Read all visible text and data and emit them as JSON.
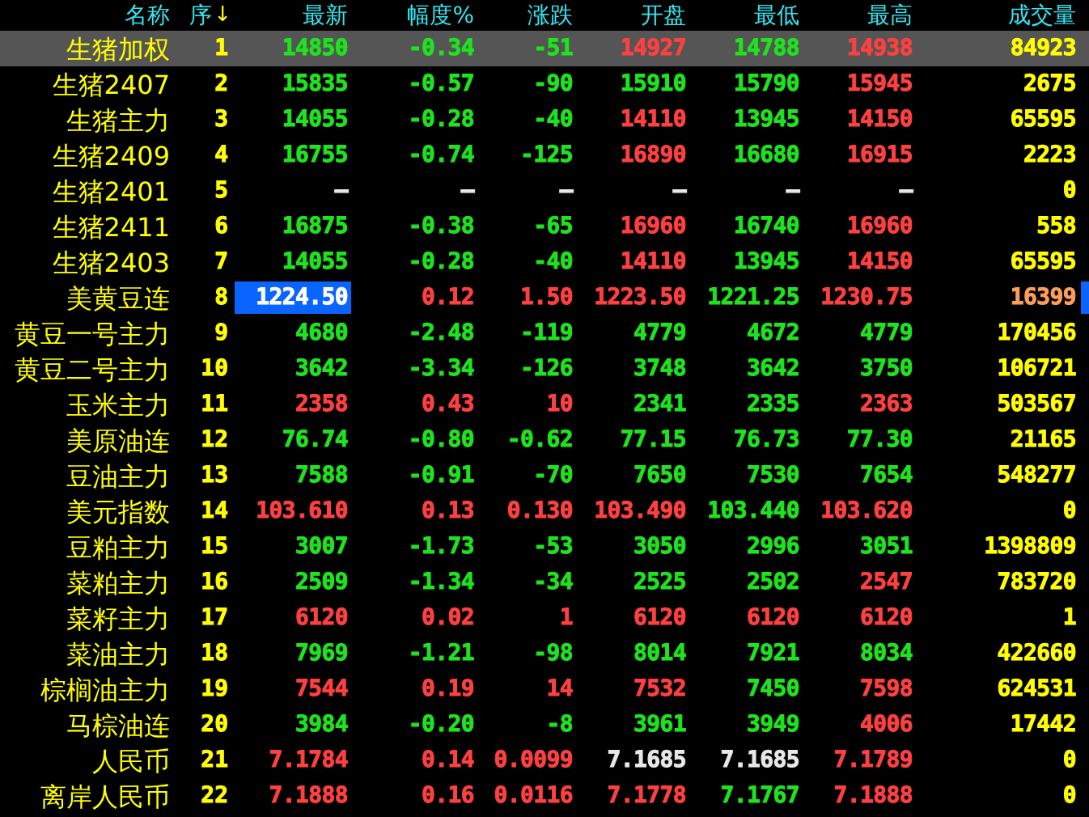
{
  "table": {
    "columns": [
      {
        "label": "名称"
      },
      {
        "label": "序",
        "sort_arrow": "↓"
      },
      {
        "label": "最新"
      },
      {
        "label": "幅度%"
      },
      {
        "label": "涨跌"
      },
      {
        "label": "开盘"
      },
      {
        "label": "最低"
      },
      {
        "label": "最高"
      },
      {
        "label": "成交量"
      }
    ],
    "rows": [
      {
        "selected": true,
        "latest_highlighted": false,
        "marked": false,
        "cells": [
          {
            "text": "生猪加权",
            "color": "#ffff00"
          },
          {
            "text": "1",
            "color": "#ffff00"
          },
          {
            "text": "14850",
            "color": "#1ee31e"
          },
          {
            "text": "-0.34",
            "color": "#1ee31e"
          },
          {
            "text": "-51",
            "color": "#1ee31e"
          },
          {
            "text": "14927",
            "color": "#ff4040"
          },
          {
            "text": "14788",
            "color": "#1ee31e"
          },
          {
            "text": "14938",
            "color": "#ff4040"
          },
          {
            "text": "84923",
            "color": "#ffff00"
          }
        ]
      },
      {
        "selected": false,
        "latest_highlighted": false,
        "marked": false,
        "cells": [
          {
            "text": "生猪2407",
            "color": "#ffff00"
          },
          {
            "text": "2",
            "color": "#ffff00"
          },
          {
            "text": "15835",
            "color": "#1ee31e"
          },
          {
            "text": "-0.57",
            "color": "#1ee31e"
          },
          {
            "text": "-90",
            "color": "#1ee31e"
          },
          {
            "text": "15910",
            "color": "#1ee31e"
          },
          {
            "text": "15790",
            "color": "#1ee31e"
          },
          {
            "text": "15945",
            "color": "#ff4040"
          },
          {
            "text": "2675",
            "color": "#ffff00"
          }
        ]
      },
      {
        "selected": false,
        "latest_highlighted": false,
        "marked": false,
        "cells": [
          {
            "text": "生猪主力",
            "color": "#ffff00"
          },
          {
            "text": "3",
            "color": "#ffff00"
          },
          {
            "text": "14055",
            "color": "#1ee31e"
          },
          {
            "text": "-0.28",
            "color": "#1ee31e"
          },
          {
            "text": "-40",
            "color": "#1ee31e"
          },
          {
            "text": "14110",
            "color": "#ff4040"
          },
          {
            "text": "13945",
            "color": "#1ee31e"
          },
          {
            "text": "14150",
            "color": "#ff4040"
          },
          {
            "text": "65595",
            "color": "#ffff00"
          }
        ]
      },
      {
        "selected": false,
        "latest_highlighted": false,
        "marked": false,
        "cells": [
          {
            "text": "生猪2409",
            "color": "#ffff00"
          },
          {
            "text": "4",
            "color": "#ffff00"
          },
          {
            "text": "16755",
            "color": "#1ee31e"
          },
          {
            "text": "-0.74",
            "color": "#1ee31e"
          },
          {
            "text": "-125",
            "color": "#1ee31e"
          },
          {
            "text": "16890",
            "color": "#ff4040"
          },
          {
            "text": "16680",
            "color": "#1ee31e"
          },
          {
            "text": "16915",
            "color": "#ff4040"
          },
          {
            "text": "2223",
            "color": "#ffff00"
          }
        ]
      },
      {
        "selected": false,
        "latest_highlighted": false,
        "marked": false,
        "cells": [
          {
            "text": "生猪2401",
            "color": "#ffff00"
          },
          {
            "text": "5",
            "color": "#ffff00"
          },
          {
            "text": "—",
            "color": "#e8e8e8"
          },
          {
            "text": "—",
            "color": "#e8e8e8"
          },
          {
            "text": "—",
            "color": "#e8e8e8"
          },
          {
            "text": "—",
            "color": "#e8e8e8"
          },
          {
            "text": "—",
            "color": "#e8e8e8"
          },
          {
            "text": "—",
            "color": "#e8e8e8"
          },
          {
            "text": "0",
            "color": "#ffff00"
          }
        ]
      },
      {
        "selected": false,
        "latest_highlighted": false,
        "marked": false,
        "cells": [
          {
            "text": "生猪2411",
            "color": "#ffff00"
          },
          {
            "text": "6",
            "color": "#ffff00"
          },
          {
            "text": "16875",
            "color": "#1ee31e"
          },
          {
            "text": "-0.38",
            "color": "#1ee31e"
          },
          {
            "text": "-65",
            "color": "#1ee31e"
          },
          {
            "text": "16960",
            "color": "#ff4040"
          },
          {
            "text": "16740",
            "color": "#1ee31e"
          },
          {
            "text": "16960",
            "color": "#ff4040"
          },
          {
            "text": "558",
            "color": "#ffff00"
          }
        ]
      },
      {
        "selected": false,
        "latest_highlighted": false,
        "marked": false,
        "cells": [
          {
            "text": "生猪2403",
            "color": "#ffff00"
          },
          {
            "text": "7",
            "color": "#ffff00"
          },
          {
            "text": "14055",
            "color": "#1ee31e"
          },
          {
            "text": "-0.28",
            "color": "#1ee31e"
          },
          {
            "text": "-40",
            "color": "#1ee31e"
          },
          {
            "text": "14110",
            "color": "#ff4040"
          },
          {
            "text": "13945",
            "color": "#1ee31e"
          },
          {
            "text": "14150",
            "color": "#ff4040"
          },
          {
            "text": "65595",
            "color": "#ffff00"
          }
        ]
      },
      {
        "selected": false,
        "latest_highlighted": true,
        "marked": true,
        "cells": [
          {
            "text": "美黄豆连",
            "color": "#ffff00"
          },
          {
            "text": "8",
            "color": "#ffff00"
          },
          {
            "text": "1224.50",
            "color": "#ffffff"
          },
          {
            "text": "0.12",
            "color": "#ff4040"
          },
          {
            "text": "1.50",
            "color": "#ff4040"
          },
          {
            "text": "1223.50",
            "color": "#ff4040"
          },
          {
            "text": "1221.25",
            "color": "#1ee31e"
          },
          {
            "text": "1230.75",
            "color": "#ff4040"
          },
          {
            "text": "16399",
            "color": "#ff9e5a"
          }
        ]
      },
      {
        "selected": false,
        "latest_highlighted": false,
        "marked": false,
        "cells": [
          {
            "text": "黄豆一号主力",
            "color": "#ffff00"
          },
          {
            "text": "9",
            "color": "#ffff00"
          },
          {
            "text": "4680",
            "color": "#1ee31e"
          },
          {
            "text": "-2.48",
            "color": "#1ee31e"
          },
          {
            "text": "-119",
            "color": "#1ee31e"
          },
          {
            "text": "4779",
            "color": "#1ee31e"
          },
          {
            "text": "4672",
            "color": "#1ee31e"
          },
          {
            "text": "4779",
            "color": "#1ee31e"
          },
          {
            "text": "170456",
            "color": "#ffff00"
          }
        ]
      },
      {
        "selected": false,
        "latest_highlighted": false,
        "marked": false,
        "cells": [
          {
            "text": "黄豆二号主力",
            "color": "#ffff00"
          },
          {
            "text": "10",
            "color": "#ffff00"
          },
          {
            "text": "3642",
            "color": "#1ee31e"
          },
          {
            "text": "-3.34",
            "color": "#1ee31e"
          },
          {
            "text": "-126",
            "color": "#1ee31e"
          },
          {
            "text": "3748",
            "color": "#1ee31e"
          },
          {
            "text": "3642",
            "color": "#1ee31e"
          },
          {
            "text": "3750",
            "color": "#1ee31e"
          },
          {
            "text": "106721",
            "color": "#ffff00"
          }
        ]
      },
      {
        "selected": false,
        "latest_highlighted": false,
        "marked": false,
        "cells": [
          {
            "text": "玉米主力",
            "color": "#ffff00"
          },
          {
            "text": "11",
            "color": "#ffff00"
          },
          {
            "text": "2358",
            "color": "#ff4040"
          },
          {
            "text": "0.43",
            "color": "#ff4040"
          },
          {
            "text": "10",
            "color": "#ff4040"
          },
          {
            "text": "2341",
            "color": "#1ee31e"
          },
          {
            "text": "2335",
            "color": "#1ee31e"
          },
          {
            "text": "2363",
            "color": "#ff4040"
          },
          {
            "text": "503567",
            "color": "#ffff00"
          }
        ]
      },
      {
        "selected": false,
        "latest_highlighted": false,
        "marked": false,
        "cells": [
          {
            "text": "美原油连",
            "color": "#ffff00"
          },
          {
            "text": "12",
            "color": "#ffff00"
          },
          {
            "text": "76.74",
            "color": "#1ee31e"
          },
          {
            "text": "-0.80",
            "color": "#1ee31e"
          },
          {
            "text": "-0.62",
            "color": "#1ee31e"
          },
          {
            "text": "77.15",
            "color": "#1ee31e"
          },
          {
            "text": "76.73",
            "color": "#1ee31e"
          },
          {
            "text": "77.30",
            "color": "#1ee31e"
          },
          {
            "text": "21165",
            "color": "#ffff00"
          }
        ]
      },
      {
        "selected": false,
        "latest_highlighted": false,
        "marked": false,
        "cells": [
          {
            "text": "豆油主力",
            "color": "#ffff00"
          },
          {
            "text": "13",
            "color": "#ffff00"
          },
          {
            "text": "7588",
            "color": "#1ee31e"
          },
          {
            "text": "-0.91",
            "color": "#1ee31e"
          },
          {
            "text": "-70",
            "color": "#1ee31e"
          },
          {
            "text": "7650",
            "color": "#1ee31e"
          },
          {
            "text": "7530",
            "color": "#1ee31e"
          },
          {
            "text": "7654",
            "color": "#1ee31e"
          },
          {
            "text": "548277",
            "color": "#ffff00"
          }
        ]
      },
      {
        "selected": false,
        "latest_highlighted": false,
        "marked": false,
        "cells": [
          {
            "text": "美元指数",
            "color": "#ffff00"
          },
          {
            "text": "14",
            "color": "#ffff00"
          },
          {
            "text": "103.610",
            "color": "#ff4040"
          },
          {
            "text": "0.13",
            "color": "#ff4040"
          },
          {
            "text": "0.130",
            "color": "#ff4040"
          },
          {
            "text": "103.490",
            "color": "#ff4040"
          },
          {
            "text": "103.440",
            "color": "#1ee31e"
          },
          {
            "text": "103.620",
            "color": "#ff4040"
          },
          {
            "text": "0",
            "color": "#ffff00"
          }
        ]
      },
      {
        "selected": false,
        "latest_highlighted": false,
        "marked": false,
        "cells": [
          {
            "text": "豆粕主力",
            "color": "#ffff00"
          },
          {
            "text": "15",
            "color": "#ffff00"
          },
          {
            "text": "3007",
            "color": "#1ee31e"
          },
          {
            "text": "-1.73",
            "color": "#1ee31e"
          },
          {
            "text": "-53",
            "color": "#1ee31e"
          },
          {
            "text": "3050",
            "color": "#1ee31e"
          },
          {
            "text": "2996",
            "color": "#1ee31e"
          },
          {
            "text": "3051",
            "color": "#1ee31e"
          },
          {
            "text": "1398809",
            "color": "#ffff00"
          }
        ]
      },
      {
        "selected": false,
        "latest_highlighted": false,
        "marked": false,
        "cells": [
          {
            "text": "菜粕主力",
            "color": "#ffff00"
          },
          {
            "text": "16",
            "color": "#ffff00"
          },
          {
            "text": "2509",
            "color": "#1ee31e"
          },
          {
            "text": "-1.34",
            "color": "#1ee31e"
          },
          {
            "text": "-34",
            "color": "#1ee31e"
          },
          {
            "text": "2525",
            "color": "#1ee31e"
          },
          {
            "text": "2502",
            "color": "#1ee31e"
          },
          {
            "text": "2547",
            "color": "#ff4040"
          },
          {
            "text": "783720",
            "color": "#ffff00"
          }
        ]
      },
      {
        "selected": false,
        "latest_highlighted": false,
        "marked": false,
        "cells": [
          {
            "text": "菜籽主力",
            "color": "#ffff00"
          },
          {
            "text": "17",
            "color": "#ffff00"
          },
          {
            "text": "6120",
            "color": "#ff4040"
          },
          {
            "text": "0.02",
            "color": "#ff4040"
          },
          {
            "text": "1",
            "color": "#ff4040"
          },
          {
            "text": "6120",
            "color": "#ff4040"
          },
          {
            "text": "6120",
            "color": "#ff4040"
          },
          {
            "text": "6120",
            "color": "#ff4040"
          },
          {
            "text": "1",
            "color": "#ffff00"
          }
        ]
      },
      {
        "selected": false,
        "latest_highlighted": false,
        "marked": false,
        "cells": [
          {
            "text": "菜油主力",
            "color": "#ffff00"
          },
          {
            "text": "18",
            "color": "#ffff00"
          },
          {
            "text": "7969",
            "color": "#1ee31e"
          },
          {
            "text": "-1.21",
            "color": "#1ee31e"
          },
          {
            "text": "-98",
            "color": "#1ee31e"
          },
          {
            "text": "8014",
            "color": "#1ee31e"
          },
          {
            "text": "7921",
            "color": "#1ee31e"
          },
          {
            "text": "8034",
            "color": "#1ee31e"
          },
          {
            "text": "422660",
            "color": "#ffff00"
          }
        ]
      },
      {
        "selected": false,
        "latest_highlighted": false,
        "marked": false,
        "cells": [
          {
            "text": "棕榈油主力",
            "color": "#ffff00"
          },
          {
            "text": "19",
            "color": "#ffff00"
          },
          {
            "text": "7544",
            "color": "#ff4040"
          },
          {
            "text": "0.19",
            "color": "#ff4040"
          },
          {
            "text": "14",
            "color": "#ff4040"
          },
          {
            "text": "7532",
            "color": "#ff4040"
          },
          {
            "text": "7450",
            "color": "#1ee31e"
          },
          {
            "text": "7598",
            "color": "#ff4040"
          },
          {
            "text": "624531",
            "color": "#ffff00"
          }
        ]
      },
      {
        "selected": false,
        "latest_highlighted": false,
        "marked": false,
        "cells": [
          {
            "text": "马棕油连",
            "color": "#ffff00"
          },
          {
            "text": "20",
            "color": "#ffff00"
          },
          {
            "text": "3984",
            "color": "#1ee31e"
          },
          {
            "text": "-0.20",
            "color": "#1ee31e"
          },
          {
            "text": "-8",
            "color": "#1ee31e"
          },
          {
            "text": "3961",
            "color": "#1ee31e"
          },
          {
            "text": "3949",
            "color": "#1ee31e"
          },
          {
            "text": "4006",
            "color": "#ff4040"
          },
          {
            "text": "17442",
            "color": "#ffff00"
          }
        ]
      },
      {
        "selected": false,
        "latest_highlighted": false,
        "marked": false,
        "cells": [
          {
            "text": "人民币",
            "color": "#ffff00"
          },
          {
            "text": "21",
            "color": "#ffff00"
          },
          {
            "text": "7.1784",
            "color": "#ff4040"
          },
          {
            "text": "0.14",
            "color": "#ff4040"
          },
          {
            "text": "0.0099",
            "color": "#ff4040"
          },
          {
            "text": "7.1685",
            "color": "#e8e8e8"
          },
          {
            "text": "7.1685",
            "color": "#e8e8e8"
          },
          {
            "text": "7.1789",
            "color": "#ff4040"
          },
          {
            "text": "0",
            "color": "#ffff00"
          }
        ]
      },
      {
        "selected": false,
        "latest_highlighted": false,
        "marked": false,
        "cells": [
          {
            "text": "离岸人民币",
            "color": "#ffff00"
          },
          {
            "text": "22",
            "color": "#ffff00"
          },
          {
            "text": "7.1888",
            "color": "#ff4040"
          },
          {
            "text": "0.16",
            "color": "#ff4040"
          },
          {
            "text": "0.0116",
            "color": "#ff4040"
          },
          {
            "text": "7.1778",
            "color": "#ff4040"
          },
          {
            "text": "7.1767",
            "color": "#1ee31e"
          },
          {
            "text": "7.1888",
            "color": "#ff4040"
          },
          {
            "text": "0",
            "color": "#ffff00"
          }
        ]
      }
    ]
  }
}
